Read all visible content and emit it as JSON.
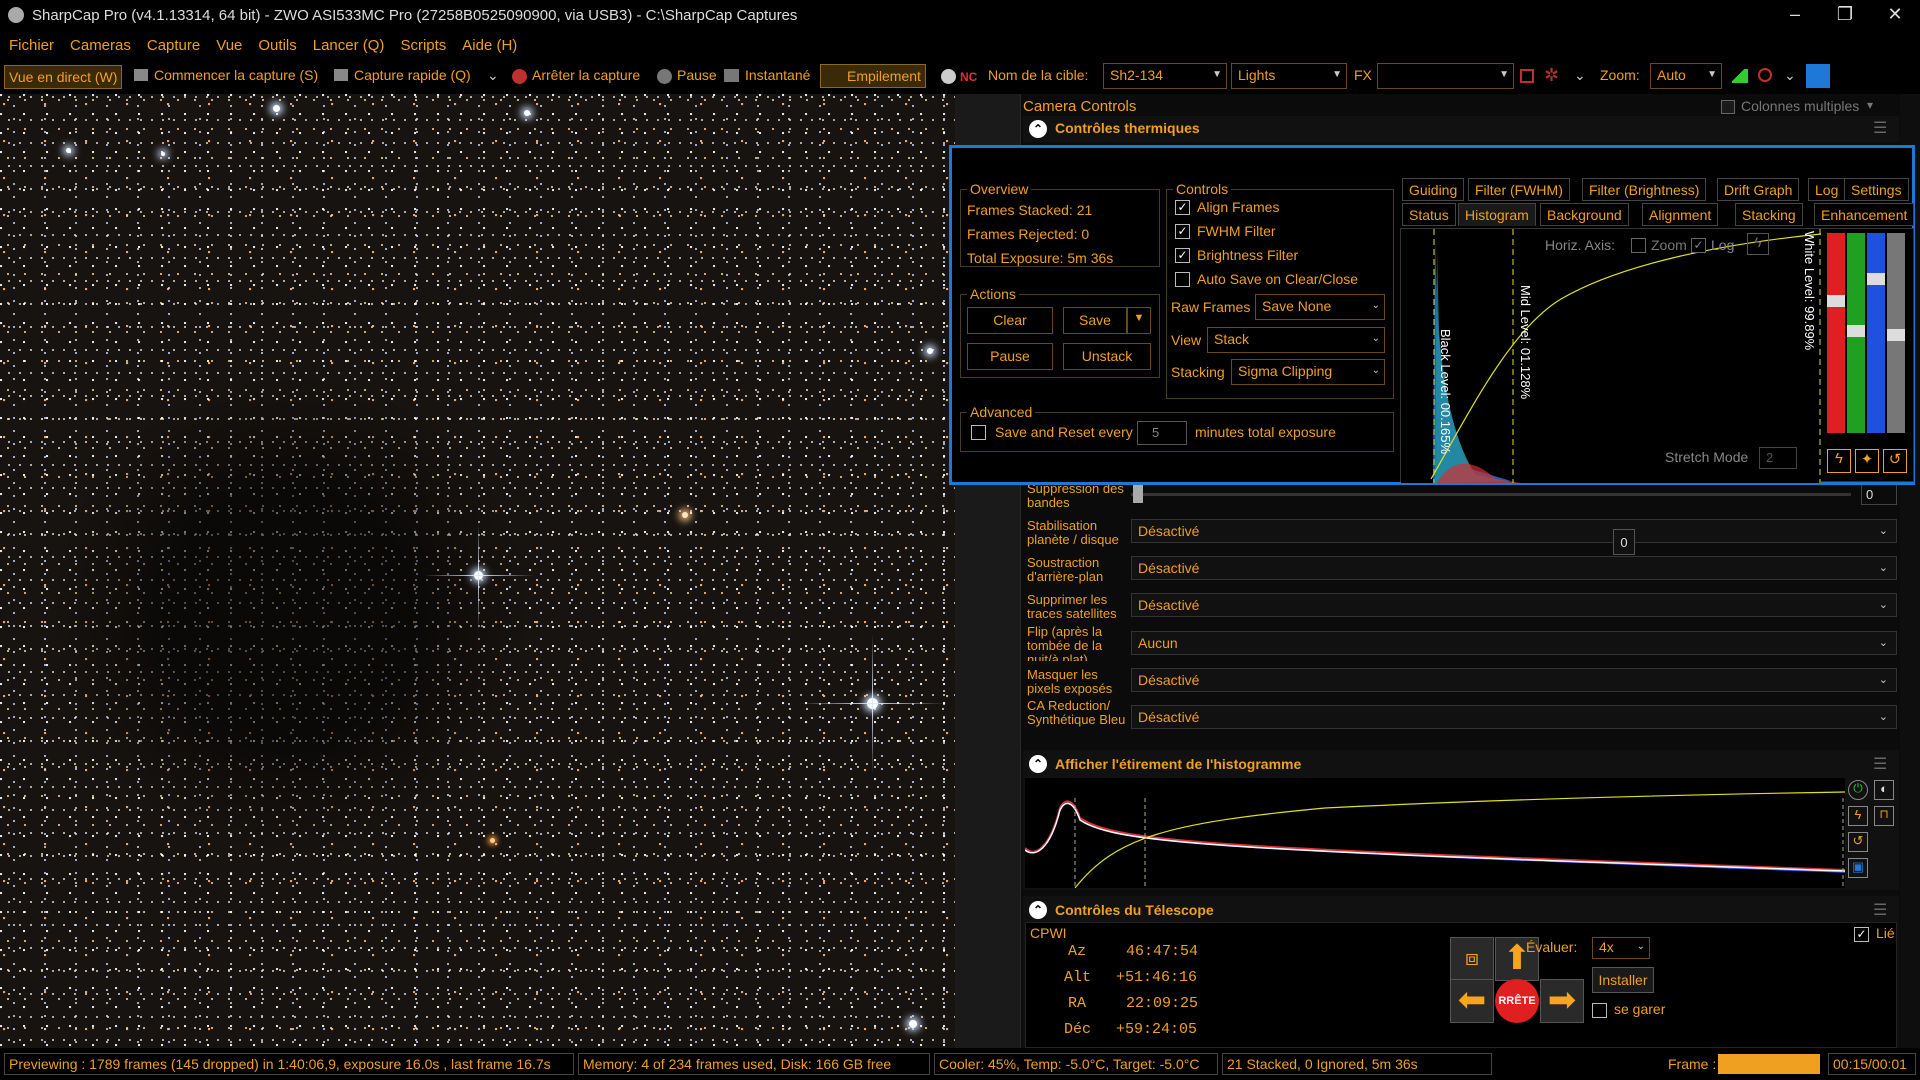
{
  "window": {
    "title": "SharpCap Pro (v4.1.13314, 64 bit) - ZWO ASI533MC Pro (27258B0525090900, via USB3) - C:\\SharpCap Captures",
    "minimize": "–",
    "maximize": "❐",
    "close": "✕"
  },
  "menu": [
    "Fichier",
    "Cameras",
    "Capture",
    "Vue",
    "Outils",
    "Lancer (Q)",
    "Scripts",
    "Aide (H)"
  ],
  "toolbar": {
    "live": "Vue en direct (W)",
    "start_capture": "Commencer la capture (S)",
    "quick_capture": "Capture rapide (Q)",
    "stop_capture": "Arrêter la capture",
    "pause": "Pause",
    "snapshot": "Instantané",
    "stacking": "Empilement",
    "target_label": "Nom de la cible:",
    "target_value": "Sh2-134",
    "frame_type": "Lights",
    "fx_label": "FX",
    "fx_value": "",
    "zoom_label": "Zoom:",
    "zoom_value": "Auto"
  },
  "panel": {
    "title": "Camera Controls",
    "multi_columns": "Colonnes multiples",
    "thermal_header": "Contrôles thermiques",
    "rows": [
      {
        "label": "Suppression des bandes",
        "value": "0"
      },
      {
        "label": "Stabilisation planète / disque",
        "value": "Désactivé"
      },
      {
        "label": "Soustraction d'arrière-plan",
        "value": "Désactivé"
      },
      {
        "label": "Supprimer les traces satellites",
        "value": "Désactivé"
      },
      {
        "label": "Flip (après la tombée de la nuit/à plat)",
        "value": "Aucun"
      },
      {
        "label": "Masquer les pixels exposés",
        "value": "Désactivé"
      },
      {
        "label": "CA Reduction/ Synthétique Bleu",
        "value": "Désactivé"
      }
    ],
    "slider_value": "0",
    "histo_header": "Afficher l'étirement de l'histogramme",
    "telescope_header": "Contrôles du Télescope",
    "telescope": {
      "mount": "CPWI",
      "linked": "Lié",
      "az_label": "Az",
      "az": "46:47:54",
      "alt_label": "Alt",
      "alt": "+51:46:16",
      "ra_label": "RA",
      "ra": "22:09:25",
      "dec_label": "Déc",
      "dec": "+59:24:05",
      "rate_label": "Évaluer:",
      "rate": "4x",
      "install": "Installer",
      "park": "se garer",
      "stop": "RRÊTE"
    }
  },
  "stack": {
    "overview_title": "Overview",
    "frames_stacked": "Frames Stacked:  21",
    "frames_rejected": "Frames Rejected: 0",
    "total_exposure": "Total Exposure:    5m 36s",
    "actions_title": "Actions",
    "clear": "Clear",
    "save": "Save",
    "pause": "Pause",
    "unstack": "Unstack",
    "advanced_title": "Advanced",
    "save_reset": "Save and Reset every",
    "save_reset_value": "5",
    "save_reset_suffix": "minutes total exposure",
    "controls_title": "Controls",
    "align": "Align Frames",
    "fwhm": "FWHM Filter",
    "brightness": "Brightness Filter",
    "autosave": "Auto Save on Clear/Close",
    "raw_label": "Raw Frames",
    "raw_value": "Save None",
    "view_label": "View",
    "view_value": "Stack",
    "stacking_label": "Stacking",
    "stacking_value": "Sigma Clipping",
    "tabs_row1": [
      "Guiding",
      "Filter (FWHM)",
      "Filter (Brightness)",
      "Drift Graph",
      "Log",
      "Settings"
    ],
    "tabs_row2": [
      "Status",
      "Histogram",
      "Background",
      "Alignment",
      "Stacking",
      "Enhancement"
    ],
    "horiz_axis": "Horiz. Axis:",
    "zoom": "Zoom",
    "log": "Log",
    "black_level": "Black Level: 00.165%",
    "mid_level": "Mid Level: 01.128%",
    "white_level": "White Level: 99.89%",
    "stretch_mode": "Stretch Mode",
    "stretch_value": "2"
  },
  "status": {
    "preview": "Previewing : 1789 frames (145 dropped) in 1:40:06,9, exposure 16.0s , last frame 16.7s",
    "memory": "Memory: 4 of 234 frames used, Disk: 166 GB free",
    "cooler": "Cooler: 45%, Temp: -5.0°C, Target: -5.0°C",
    "stacked": "21 Stacked, 0 Ignored, 5m 36s",
    "frame_label": "Frame :",
    "time": "00:15/00:01"
  },
  "colors": {
    "accent": "#f0a020",
    "highlight": "#1e78d8",
    "stop_red": "#e02020"
  }
}
